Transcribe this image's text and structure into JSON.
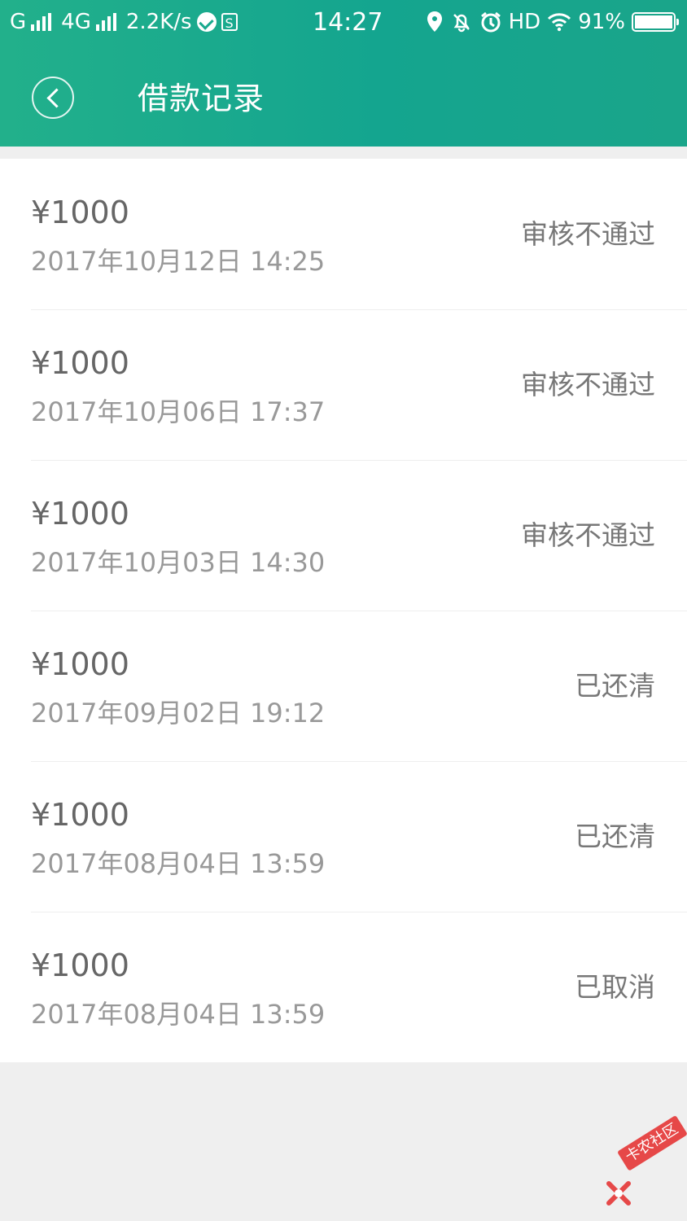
{
  "status_bar": {
    "left_text": "G",
    "network_type": "4G",
    "speed": "2.2K/s",
    "time": "14:27",
    "hd": "HD",
    "battery": "91%"
  },
  "header": {
    "title": "借款记录"
  },
  "loans": [
    {
      "amount": "¥1000",
      "date": "2017年10月12日 14:25",
      "status": "审核不通过"
    },
    {
      "amount": "¥1000",
      "date": "2017年10月06日 17:37",
      "status": "审核不通过"
    },
    {
      "amount": "¥1000",
      "date": "2017年10月03日 14:30",
      "status": "审核不通过"
    },
    {
      "amount": "¥1000",
      "date": "2017年09月02日 19:12",
      "status": "已还清"
    },
    {
      "amount": "¥1000",
      "date": "2017年08月04日 13:59",
      "status": "已还清"
    },
    {
      "amount": "¥1000",
      "date": "2017年08月04日 13:59",
      "status": "已取消"
    }
  ],
  "watermark": {
    "text": "卡农社区"
  },
  "icons": {
    "back": "back-icon",
    "location": "location-icon",
    "mute": "mute-icon",
    "alarm": "alarm-icon",
    "wifi": "wifi-icon",
    "battery": "battery-icon"
  },
  "colors": {
    "header_green": "#14a58f",
    "background": "#efefef"
  }
}
